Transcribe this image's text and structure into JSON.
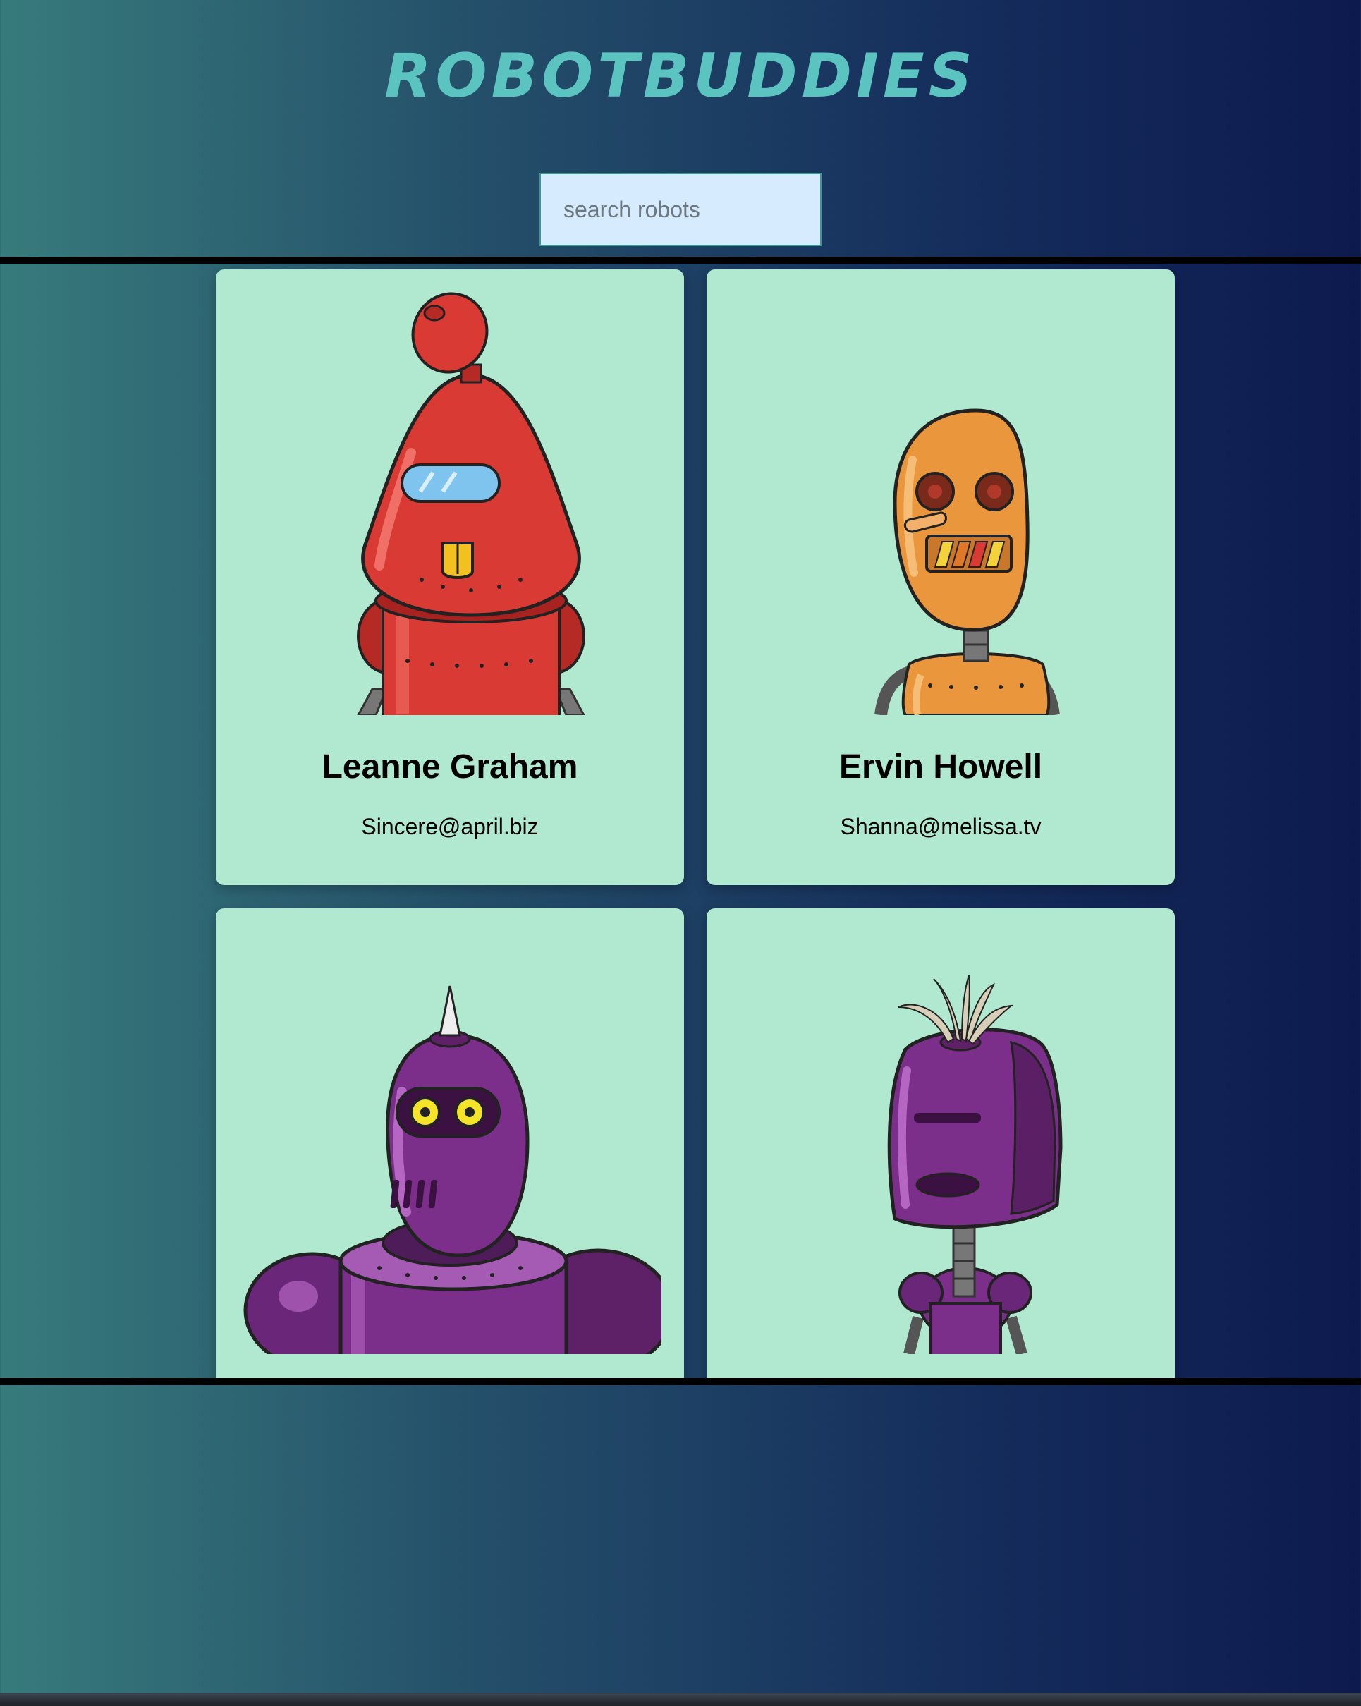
{
  "header": {
    "logo_text": "ROBOTBUDDIES",
    "logo_color": "#5bc3c0"
  },
  "search": {
    "placeholder": "search robots",
    "value": ""
  },
  "robots": [
    {
      "name": "Leanne Graham",
      "email": "Sincere@april.biz",
      "color": "#d93a33",
      "avatar_icon": "red-robot-icon"
    },
    {
      "name": "Ervin Howell",
      "email": "Shanna@melissa.tv",
      "color": "#e9963c",
      "avatar_icon": "orange-robot-icon"
    },
    {
      "name": "",
      "email": "",
      "color": "#7b2e8a",
      "avatar_icon": "purple-horned-robot-icon"
    },
    {
      "name": "",
      "email": "",
      "color": "#7b2e8a",
      "avatar_icon": "purple-tufted-robot-icon"
    }
  ],
  "colors": {
    "card_background": "#b0e8d0",
    "search_background": "#d6ebfd"
  }
}
